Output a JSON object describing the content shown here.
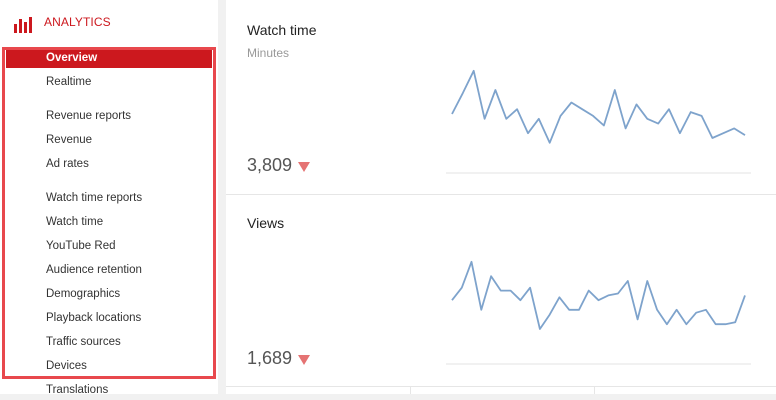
{
  "header": {
    "title": "ANALYTICS",
    "icon": "analytics-bars-icon"
  },
  "sidebar": {
    "items": [
      {
        "label": "Overview",
        "active": true
      },
      {
        "label": "Realtime"
      },
      {
        "label": "Revenue reports"
      },
      {
        "label": "Revenue"
      },
      {
        "label": "Ad rates"
      },
      {
        "label": "Watch time reports"
      },
      {
        "label": "Watch time"
      },
      {
        "label": "YouTube Red"
      },
      {
        "label": "Audience retention"
      },
      {
        "label": "Demographics"
      },
      {
        "label": "Playback locations"
      },
      {
        "label": "Traffic sources"
      },
      {
        "label": "Devices"
      },
      {
        "label": "Translations"
      }
    ]
  },
  "cards": [
    {
      "title": "Watch time",
      "subtitle": "Minutes",
      "value": "3,809",
      "trend": "down",
      "sparkline": [
        50,
        72,
        95,
        45,
        75,
        45,
        55,
        30,
        45,
        20,
        48,
        62,
        55,
        48,
        38,
        75,
        35,
        60,
        45,
        40,
        55,
        30,
        52,
        48,
        25,
        30,
        35,
        28
      ]
    },
    {
      "title": "Views",
      "subtitle": "",
      "value": "1,689",
      "trend": "down",
      "sparkline": [
        55,
        68,
        95,
        45,
        80,
        65,
        65,
        55,
        68,
        25,
        40,
        58,
        45,
        45,
        65,
        55,
        60,
        62,
        75,
        35,
        75,
        45,
        30,
        45,
        30,
        42,
        45,
        30,
        30,
        32,
        60
      ]
    }
  ],
  "colors": {
    "accent": "#cc181e",
    "spark": "#7ea3cc",
    "trend_down": "#e57373"
  }
}
